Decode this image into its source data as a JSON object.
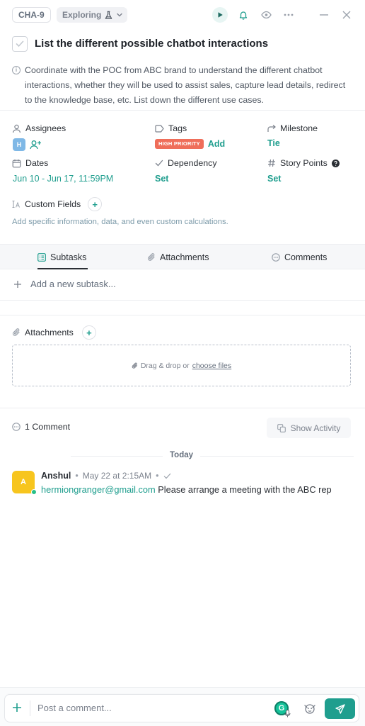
{
  "header": {
    "task_id": "CHA-9",
    "status": "Exploring",
    "icons": [
      "play-icon",
      "bell-icon",
      "eye-icon",
      "more-icon",
      "minimize-icon",
      "close-icon"
    ]
  },
  "task": {
    "title": "List the different possible chatbot interactions",
    "description": "Coordinate with the POC from ABC brand to understand the different chatbot interactions, whether they will be used to assist sales, capture lead details, redirect to the knowledge base, etc. List down the different use cases."
  },
  "fields": {
    "assignees": {
      "label": "Assignees",
      "avatar_initial": "H"
    },
    "tags": {
      "label": "Tags",
      "tag": "HIGH PRIORITY",
      "add_label": "Add"
    },
    "milestone": {
      "label": "Milestone",
      "value": "Tie"
    },
    "dates": {
      "label": "Dates",
      "value": "Jun 10 - Jun 17, 11:59PM"
    },
    "dependency": {
      "label": "Dependency",
      "value": "Set"
    },
    "story_points": {
      "label": "Story Points",
      "value": "Set"
    },
    "custom_fields": {
      "label": "Custom Fields",
      "hint": "Add specific information, data, and even custom calculations."
    }
  },
  "tabs": [
    {
      "label": "Subtasks",
      "active": true
    },
    {
      "label": "Attachments",
      "active": false
    },
    {
      "label": "Comments",
      "active": false
    }
  ],
  "subtasks": {
    "add_placeholder": "Add a new subtask..."
  },
  "attachments": {
    "label": "Attachments",
    "dropzone_text": "Drag & drop or",
    "dropzone_link": "choose files"
  },
  "comments": {
    "count_label": "1 Comment",
    "show_activity": "Show Activity",
    "day_divider": "Today",
    "items": [
      {
        "avatar_initial": "A",
        "author": "Anshul",
        "timestamp": "May 22 at 2:15AM",
        "mention": "hermiongranger@gmail.com",
        "text": "Please arrange a meeting with the ABC rep"
      }
    ]
  },
  "composer": {
    "placeholder": "Post a comment...",
    "grammarly_badge": "G"
  },
  "colors": {
    "accent": "#1f9e8e",
    "tag": "#ef6e5a",
    "comment_avatar": "#f7c51e",
    "assignee_avatar": "#7fb8e6"
  }
}
